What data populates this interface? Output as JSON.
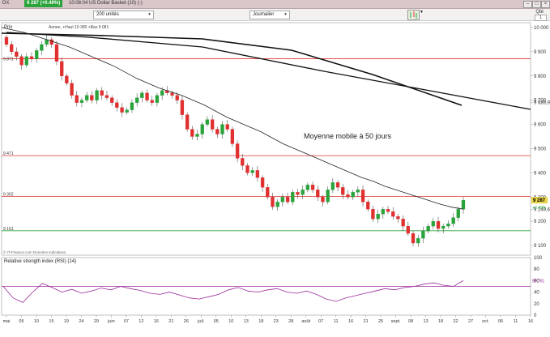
{
  "header": {
    "symbol": "DX",
    "price_badge": "9 287 (+0.49%)",
    "description": "10:08:04 US Dollar Basket (10) (-)"
  },
  "toolbar": {
    "units_select": "200 unités",
    "period_select": "Journalier",
    "qte_label": "Qté",
    "qte_value": "1"
  },
  "price_panel": {
    "title": "Prix",
    "ohlc_info": "Annee, +Haut 10 380 +Bas 9 081",
    "annotation": "Moyenne mobile à 50 jours",
    "source": "© IT-Finance.com Données indicatives",
    "axis_labels": [
      "10 000",
      "9 900",
      "9 800",
      "9 700",
      "9 689,9",
      "9 600",
      "9 500",
      "9 400",
      "9 300",
      "9 249,6",
      "9 200",
      "9 100"
    ],
    "current_price": "9 287",
    "current_change": "+0.49%",
    "level_labels": [
      "9 471",
      "9 302",
      "9 161"
    ],
    "left_tag": "9 871",
    "level_color": "#e03030",
    "support_color": "#2aa33b"
  },
  "rsi_panel": {
    "title": "Relative strength index (RSI) (14)",
    "axis_labels": [
      "100",
      "80",
      "60",
      "40",
      "20",
      "0"
    ],
    "current_value": "59,781",
    "line_color": "#9b2a9b"
  },
  "x_axis": {
    "labels": [
      "mai",
      "05",
      "10",
      "15",
      "19",
      "24",
      "29",
      "juin",
      "07",
      "12",
      "16",
      "21",
      "26",
      "juil.",
      "05",
      "10",
      "13",
      "18",
      "23",
      "28",
      "août",
      "07",
      "11",
      "16",
      "21",
      "25",
      "sept.",
      "08",
      "13",
      "18",
      "22",
      "27",
      "oct.",
      "06",
      "11",
      "16"
    ]
  },
  "chart_data": {
    "type": "candlestick",
    "title": "Prix",
    "ylim": [
      9060,
      10020
    ],
    "horizontal_levels": [
      9871,
      9471,
      9302,
      9161
    ],
    "long_trendlines": [
      {
        "x_start": "mai",
        "y_start": 10000,
        "x_end": "oct.",
        "y_end": 9700
      },
      {
        "x_start": "juin",
        "y_end": 9700
      }
    ],
    "closes": [
      9930,
      9900,
      9880,
      9845,
      9880,
      9870,
      9905,
      9930,
      9950,
      9930,
      9860,
      9800,
      9770,
      9720,
      9690,
      9700,
      9720,
      9700,
      9740,
      9720,
      9710,
      9690,
      9670,
      9650,
      9660,
      9690,
      9710,
      9730,
      9700,
      9690,
      9720,
      9740,
      9730,
      9720,
      9700,
      9640,
      9580,
      9550,
      9560,
      9600,
      9620,
      9580,
      9560,
      9600,
      9580,
      9520,
      9460,
      9430,
      9400,
      9410,
      9380,
      9340,
      9300,
      9260,
      9280,
      9300,
      9280,
      9320,
      9310,
      9330,
      9350,
      9330,
      9300,
      9280,
      9330,
      9360,
      9340,
      9310,
      9300,
      9320,
      9330,
      9280,
      9250,
      9210,
      9230,
      9250,
      9240,
      9220,
      9210,
      9180,
      9150,
      9110,
      9130,
      9160,
      9180,
      9200,
      9170,
      9180,
      9190,
      9215,
      9250,
      9287
    ],
    "ma50": [
      10000,
      9990,
      9980,
      9965,
      9950,
      9935,
      9920,
      9900,
      9880,
      9860,
      9840,
      9815,
      9790,
      9770,
      9750,
      9735,
      9720,
      9700,
      9680,
      9655,
      9630,
      9610,
      9590,
      9570,
      9545,
      9520,
      9500,
      9480,
      9460,
      9440,
      9420,
      9400,
      9380,
      9365,
      9345,
      9330,
      9315,
      9300,
      9285,
      9270,
      9258,
      9250
    ],
    "rsi": [
      50,
      30,
      22,
      40,
      55,
      48,
      40,
      45,
      38,
      42,
      47,
      44,
      50,
      46,
      43,
      38,
      36,
      40,
      35,
      30,
      28,
      32,
      36,
      44,
      48,
      42,
      40,
      44,
      46,
      40,
      38,
      42,
      36,
      28,
      24,
      30,
      34,
      38,
      42,
      46,
      44,
      48,
      50,
      54,
      56,
      52,
      50,
      60
    ]
  }
}
